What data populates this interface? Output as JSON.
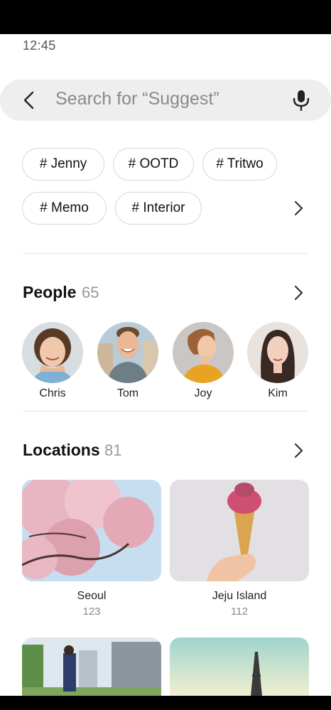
{
  "status": {
    "time": "12:45"
  },
  "search": {
    "placeholder": "Search for “Suggest”"
  },
  "tags": [
    "# Jenny",
    "# OOTD",
    "# Tritwo",
    "# Memo",
    "# Interior"
  ],
  "people": {
    "title": "People",
    "count": "65",
    "items": [
      "Chris",
      "Tom",
      "Joy",
      "Kim"
    ]
  },
  "locations": {
    "title": "Locations",
    "count": "81",
    "items": [
      {
        "name": "Seoul",
        "count": "123"
      },
      {
        "name": "Jeju Island",
        "count": "112"
      }
    ]
  },
  "icons": {
    "back": "back-arrow-icon",
    "mic": "microphone-icon",
    "more": "chevron-right-icon"
  }
}
